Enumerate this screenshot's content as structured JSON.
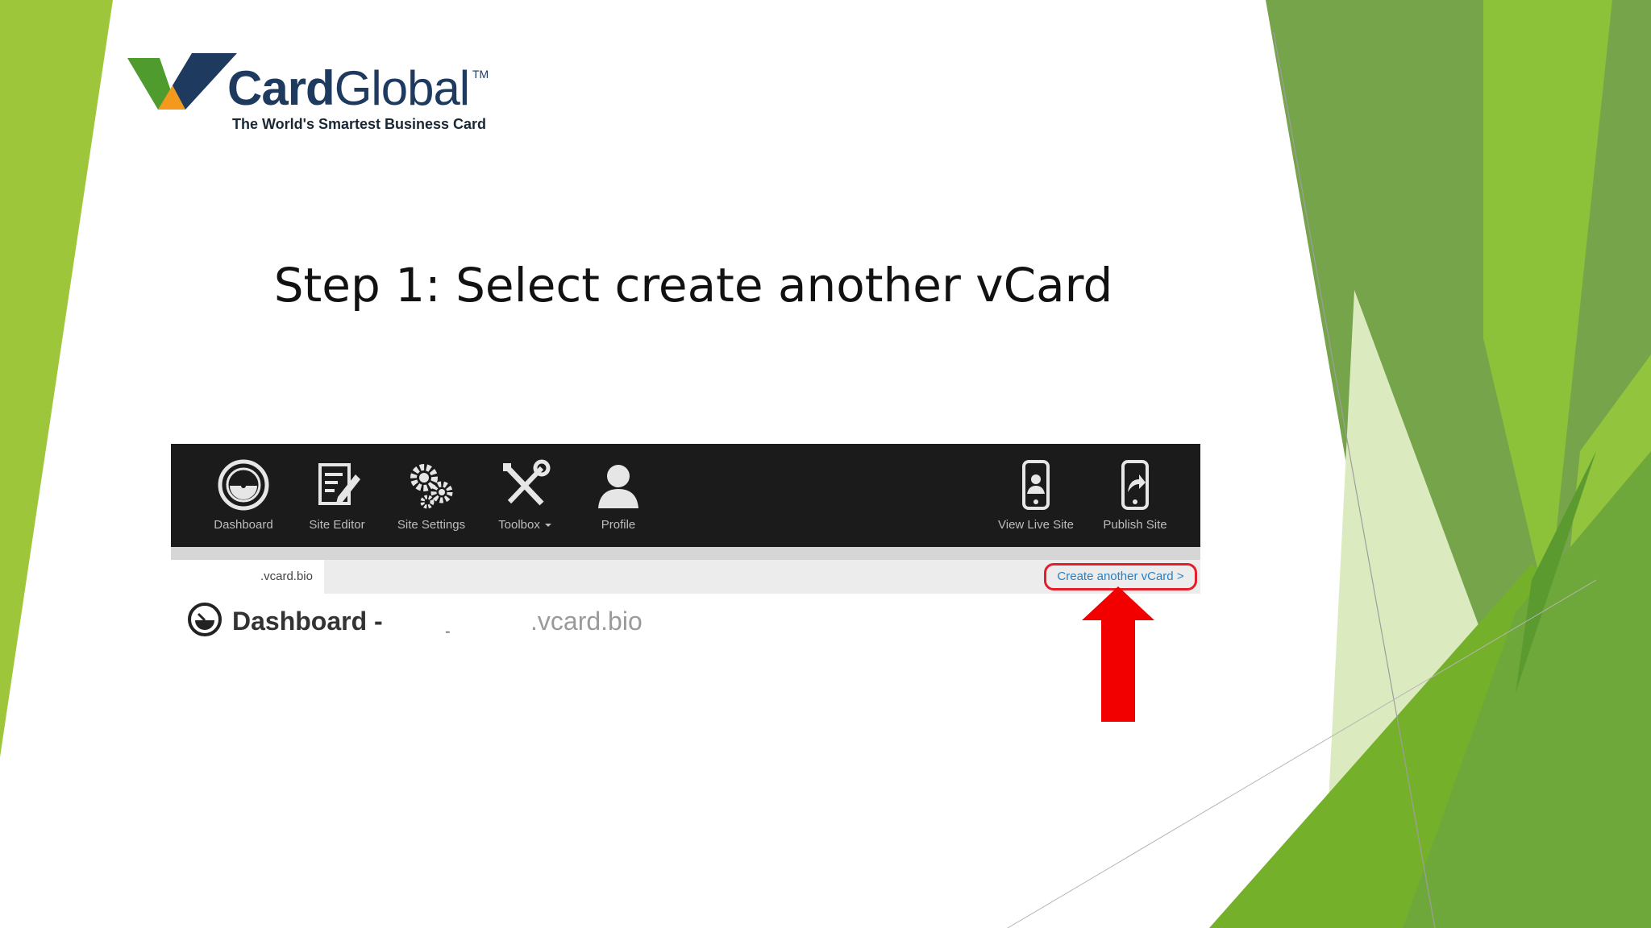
{
  "slide": {
    "title": "Step 1: Select create another vCard",
    "accent_colors": {
      "green_light": "#9dc63b",
      "green_mid": "#75b02b",
      "green_dark": "#5a9a2e",
      "arrow_red": "#f20000"
    }
  },
  "logo": {
    "brand_bold": "Card",
    "brand_light": "Global",
    "trademark": "TM",
    "tagline": "The World's Smartest Business Card",
    "mark_colors": {
      "green": "#4f9b2d",
      "orange": "#f39a1e",
      "navy": "#1e3a5f"
    }
  },
  "app": {
    "nav_left": [
      {
        "label": "Dashboard",
        "icon": "dashboard-gauge-icon"
      },
      {
        "label": "Site Editor",
        "icon": "edit-document-icon"
      },
      {
        "label": "Site Settings",
        "icon": "gears-icon"
      },
      {
        "label": "Toolbox",
        "icon": "wrench-screwdriver-icon",
        "dropdown": true
      },
      {
        "label": "Profile",
        "icon": "user-icon"
      }
    ],
    "nav_right": [
      {
        "label": "View Live Site",
        "icon": "phone-user-icon"
      },
      {
        "label": "Publish Site",
        "icon": "phone-share-icon"
      }
    ],
    "site_tab": ".vcard.bio",
    "create_link": "Create another vCard >",
    "dashboard": {
      "title": "Dashboard -",
      "redaction_mark": "-",
      "domain": ".vcard.bio"
    }
  }
}
